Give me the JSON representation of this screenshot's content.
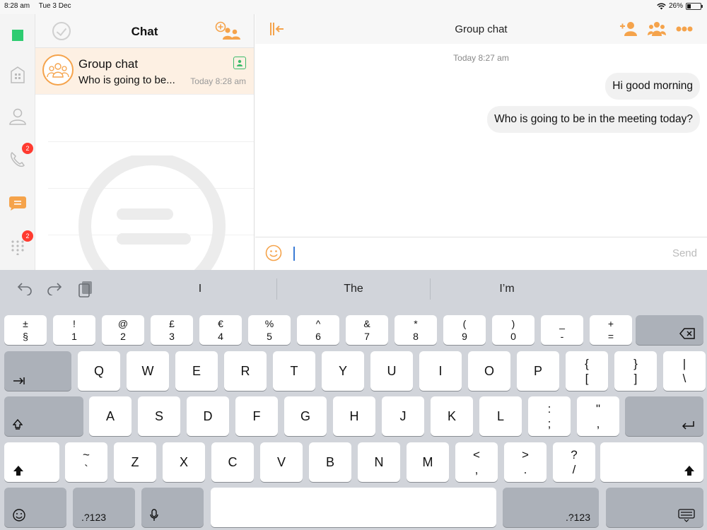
{
  "status": {
    "time": "8:28 am",
    "date": "Tue 3 Dec",
    "battery": "26%",
    "battery_level": 0.26
  },
  "rail": {
    "calls_badge": "2",
    "dialpad_badge": "2",
    "accent": "#f5a34b",
    "status_color": "#2ecc71"
  },
  "list": {
    "title": "Chat",
    "chats": [
      {
        "name": "Group chat",
        "preview": "Who is going to be...",
        "time": "Today 8:28 am"
      }
    ]
  },
  "conversation": {
    "title": "Group chat",
    "date_separator": "Today 8:27 am",
    "messages": [
      {
        "text": "Hi good morning"
      },
      {
        "text": "Who is going to be in the meeting today?"
      }
    ],
    "send_label": "Send"
  },
  "keyboard": {
    "suggestions": [
      "I",
      "The",
      "I’m"
    ],
    "number_row": [
      [
        "±",
        "§"
      ],
      [
        "!",
        "1"
      ],
      [
        "@",
        "2"
      ],
      [
        "£",
        "3"
      ],
      [
        "€",
        "4"
      ],
      [
        "%",
        "5"
      ],
      [
        "^",
        "6"
      ],
      [
        "&",
        "7"
      ],
      [
        "*",
        "8"
      ],
      [
        "(",
        "9"
      ],
      [
        ")",
        "0"
      ],
      [
        "_",
        "-"
      ],
      [
        "+",
        "="
      ]
    ],
    "row_q": [
      "Q",
      "W",
      "E",
      "R",
      "T",
      "Y",
      "U",
      "I",
      "O",
      "P"
    ],
    "row_q_sym": [
      [
        "{",
        "["
      ],
      [
        "}",
        "]"
      ],
      [
        "|",
        "\\"
      ]
    ],
    "row_a": [
      "A",
      "S",
      "D",
      "F",
      "G",
      "H",
      "J",
      "K",
      "L"
    ],
    "row_a_sym": [
      [
        ":",
        ";"
      ],
      [
        "\"",
        ","
      ]
    ],
    "row_z_sym_left": [
      "~",
      "`"
    ],
    "row_z": [
      "Z",
      "X",
      "C",
      "V",
      "B",
      "N",
      "M"
    ],
    "row_z_sym": [
      [
        "<",
        ","
      ],
      [
        ">",
        "."
      ],
      [
        "?",
        "/"
      ]
    ],
    "mode_label": ".?123"
  }
}
